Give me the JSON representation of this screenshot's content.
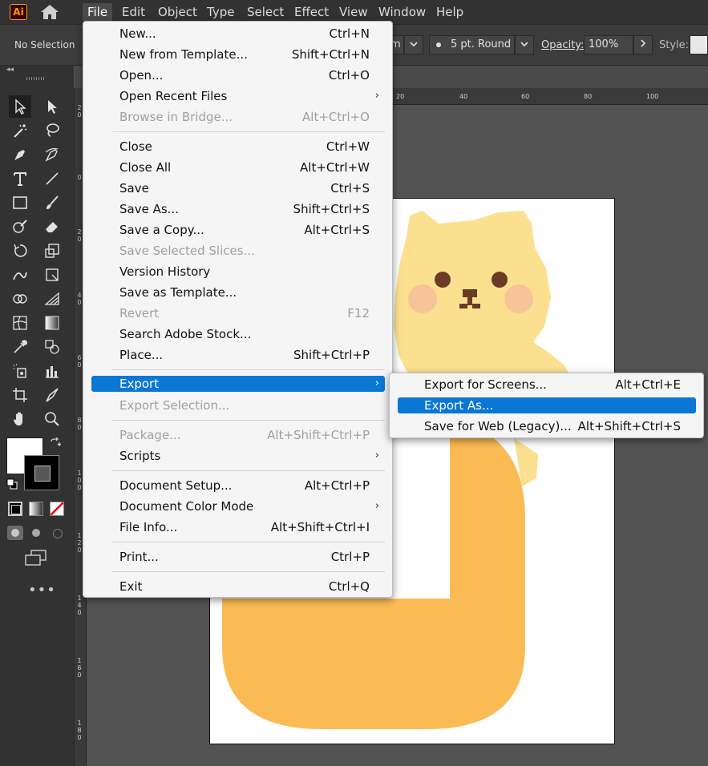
{
  "app": {
    "logo_text": "Ai"
  },
  "menubar": {
    "items": [
      "File",
      "Edit",
      "Object",
      "Type",
      "Select",
      "Effect",
      "View",
      "Window",
      "Help"
    ],
    "active": "File"
  },
  "control_bar": {
    "selection_label": "No Selection",
    "stroke_unit_partial": "m",
    "brush_label": "5 pt. Round",
    "opacity_label": "Opacity:",
    "opacity_value": "100%",
    "style_label": "Style:"
  },
  "ruler": {
    "top_ticks": [
      "20",
      "40",
      "60",
      "80",
      "100"
    ],
    "left_ticks": [
      "2\n0",
      "0",
      "2\n0",
      "4\n0",
      "6\n0",
      "8\n0",
      "1\n0\n0",
      "1\n2\n0",
      "1\n4\n0",
      "1\n6\n0",
      "1\n8\n0"
    ]
  },
  "file_menu": {
    "items": [
      {
        "label": "New...",
        "shortcut": "Ctrl+N"
      },
      {
        "label": "New from Template...",
        "shortcut": "Shift+Ctrl+N"
      },
      {
        "label": "Open...",
        "shortcut": "Ctrl+O"
      },
      {
        "label": "Open Recent Files",
        "shortcut": ""
      },
      {
        "label": "Browse in Bridge...",
        "shortcut": "Alt+Ctrl+O"
      },
      {
        "label": "Close",
        "shortcut": "Ctrl+W"
      },
      {
        "label": "Close All",
        "shortcut": "Alt+Ctrl+W"
      },
      {
        "label": "Save",
        "shortcut": "Ctrl+S"
      },
      {
        "label": "Save As...",
        "shortcut": "Shift+Ctrl+S"
      },
      {
        "label": "Save a Copy...",
        "shortcut": "Alt+Ctrl+S"
      },
      {
        "label": "Save Selected Slices...",
        "shortcut": ""
      },
      {
        "label": "Version History",
        "shortcut": ""
      },
      {
        "label": "Save as Template...",
        "shortcut": ""
      },
      {
        "label": "Revert",
        "shortcut": "F12"
      },
      {
        "label": "Search Adobe Stock...",
        "shortcut": ""
      },
      {
        "label": "Place...",
        "shortcut": "Shift+Ctrl+P"
      },
      {
        "label": "Export",
        "shortcut": ""
      },
      {
        "label": "Export Selection...",
        "shortcut": ""
      },
      {
        "label": "Package...",
        "shortcut": "Alt+Shift+Ctrl+P"
      },
      {
        "label": "Scripts",
        "shortcut": ""
      },
      {
        "label": "Document Setup...",
        "shortcut": "Alt+Ctrl+P"
      },
      {
        "label": "Document Color Mode",
        "shortcut": ""
      },
      {
        "label": "File Info...",
        "shortcut": "Alt+Shift+Ctrl+I"
      },
      {
        "label": "Print...",
        "shortcut": "Ctrl+P"
      },
      {
        "label": "Exit",
        "shortcut": "Ctrl+Q"
      }
    ]
  },
  "export_submenu": {
    "items": [
      {
        "label": "Export for Screens...",
        "shortcut": "Alt+Ctrl+E"
      },
      {
        "label": "Export As...",
        "shortcut": ""
      },
      {
        "label": "Save for Web (Legacy)...",
        "shortcut": "Alt+Shift+Ctrl+S"
      }
    ]
  },
  "colors": {
    "menu_highlight": "#0a77d4",
    "app_bg": "#535353",
    "panel_bg": "#323232",
    "bear_yellow": "#fbe08f",
    "body_orange": "#fbbb54",
    "cheek_pink": "#f7c49a",
    "eye_brown": "#6b3b26"
  }
}
